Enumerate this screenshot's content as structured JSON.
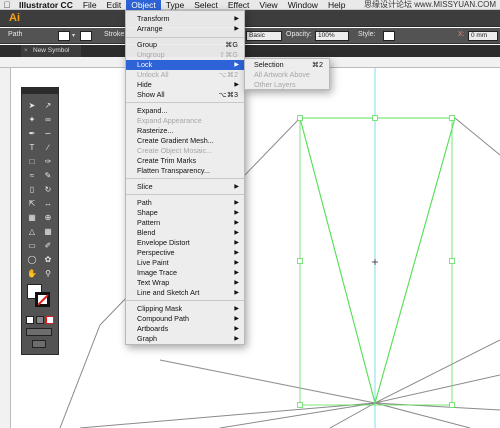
{
  "menubar": {
    "app_name": "Illustrator CC",
    "items": [
      "File",
      "Edit",
      "Object",
      "Type",
      "Select",
      "Effect",
      "View",
      "Window",
      "Help"
    ],
    "active_item": "Object",
    "watermark": "思缘设计论坛 www.MISSYUAN.COM"
  },
  "appbar": {
    "logo": "Ai"
  },
  "controlbar": {
    "path_label": "Path",
    "stroke_label": "Stroke:",
    "brush_value": "Basic",
    "opacity_label": "Opacity:",
    "opacity_value": "100%",
    "style_label": "Style:",
    "x_label": "X:",
    "x_value": "0 mm"
  },
  "document": {
    "tab_name": "New Symbol",
    "tab_close": "×"
  },
  "object_menu": {
    "items": [
      {
        "label": "Transform",
        "submenu": true
      },
      {
        "label": "Arrange",
        "submenu": true
      },
      {
        "label": "Group",
        "shortcut": "⌘G"
      },
      {
        "label": "Ungroup",
        "shortcut": "⇧⌘G",
        "disabled": true
      },
      {
        "label": "Lock",
        "submenu": true,
        "highlighted": true
      },
      {
        "label": "Unlock All",
        "shortcut": "⌥⌘2",
        "disabled": true
      },
      {
        "label": "Hide",
        "submenu": true
      },
      {
        "label": "Show All",
        "shortcut": "⌥⌘3"
      },
      {
        "label": "Expand..."
      },
      {
        "label": "Expand Appearance",
        "disabled": true
      },
      {
        "label": "Rasterize..."
      },
      {
        "label": "Create Gradient Mesh..."
      },
      {
        "label": "Create Object Mosaic...",
        "disabled": true
      },
      {
        "label": "Create Trim Marks"
      },
      {
        "label": "Flatten Transparency..."
      },
      {
        "label": "Slice",
        "submenu": true
      },
      {
        "label": "Path",
        "submenu": true
      },
      {
        "label": "Shape",
        "submenu": true
      },
      {
        "label": "Pattern",
        "submenu": true
      },
      {
        "label": "Blend",
        "submenu": true
      },
      {
        "label": "Envelope Distort",
        "submenu": true
      },
      {
        "label": "Perspective",
        "submenu": true
      },
      {
        "label": "Live Paint",
        "submenu": true
      },
      {
        "label": "Image Trace",
        "submenu": true
      },
      {
        "label": "Text Wrap",
        "submenu": true
      },
      {
        "label": "Line and Sketch Art",
        "submenu": true
      },
      {
        "label": "Clipping Mask",
        "submenu": true
      },
      {
        "label": "Compound Path",
        "submenu": true
      },
      {
        "label": "Artboards",
        "submenu": true
      },
      {
        "label": "Graph",
        "submenu": true
      }
    ],
    "submenu_arrow": "▶"
  },
  "lock_submenu": {
    "items": [
      {
        "label": "Selection",
        "shortcut": "⌘2"
      },
      {
        "label": "All Artwork Above",
        "disabled": true
      },
      {
        "label": "Other Layers",
        "disabled": true
      }
    ]
  },
  "toolbox": {
    "tools": [
      "selection-tool",
      "direct-selection-tool",
      "magic-wand-tool",
      "lasso-tool",
      "pen-tool",
      "curvature-tool",
      "type-tool",
      "line-segment-tool",
      "rectangle-tool",
      "paintbrush-tool",
      "shaper-tool",
      "pencil-tool",
      "eraser-tool",
      "rotate-tool",
      "scale-tool",
      "width-tool",
      "free-transform-tool",
      "shape-builder-tool",
      "perspective-grid-tool",
      "mesh-tool",
      "gradient-tool",
      "eyedropper-tool",
      "blend-tool",
      "symbol-sprayer-tool",
      "column-graph-tool",
      "artboard-tool",
      "slice-tool",
      "hand-tool",
      "zoom-tool"
    ],
    "fill_color": "#ffffff",
    "stroke_color": "#111111"
  },
  "colors": {
    "menu_highlight": "#2d63d6",
    "selection_green": "#5be05b",
    "guide_cyan": "#7fdde8",
    "ai_orange": "#f7a11a"
  }
}
